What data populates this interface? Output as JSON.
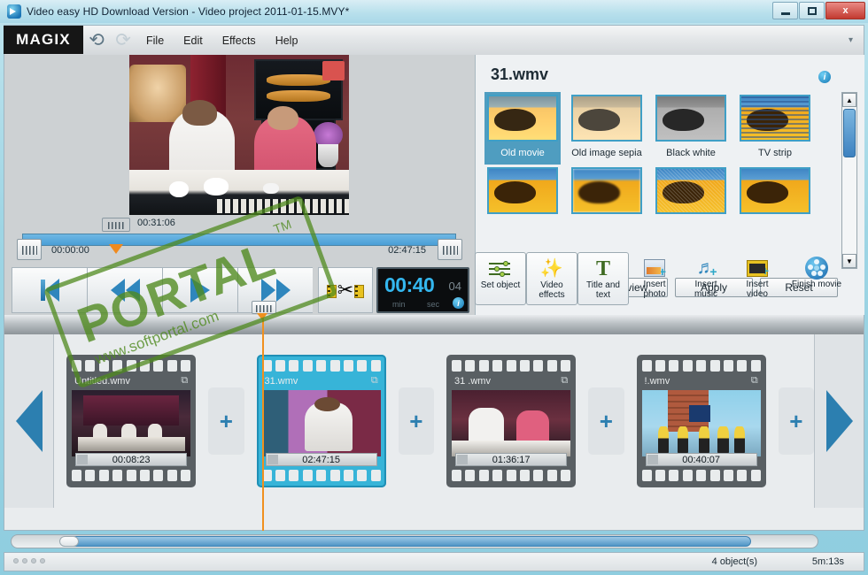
{
  "window": {
    "title": "Video easy HD Download Version - Video project 2011-01-15.MVY*",
    "app_icon": "video-app-icon",
    "minimize_label": "Minimize",
    "maximize_label": "Maximize",
    "close_label": "x"
  },
  "menubar": {
    "logo": "MAGIX",
    "undo_icon": "undo-arrow-icon",
    "redo_icon": "redo-arrow-icon",
    "items": [
      "File",
      "Edit",
      "Effects",
      "Help"
    ],
    "caret": "▾"
  },
  "preview": {
    "marker_time": "00:31:06",
    "start_time": "00:00:00",
    "end_time": "02:47:15"
  },
  "transport": {
    "buttons": [
      {
        "name": "skip-start",
        "icon": "skip-to-start-icon"
      },
      {
        "name": "rewind",
        "icon": "rewind-icon"
      },
      {
        "name": "play",
        "icon": "play-icon"
      },
      {
        "name": "fast-forward",
        "icon": "fast-forward-icon"
      },
      {
        "name": "cut",
        "icon": "scissors-cut-icon"
      }
    ]
  },
  "time_display": {
    "main": "00:40",
    "frames": "04",
    "label_min": "min",
    "label_sec": "sec",
    "info_icon": "i"
  },
  "effects": {
    "title": "31.wmv",
    "info_icon": "i",
    "selected": "Old movie",
    "items": [
      {
        "label": "Old movie",
        "style": "old",
        "selected": true
      },
      {
        "label": "Old image sepia",
        "style": "sepia",
        "selected": false
      },
      {
        "label": "Black white",
        "style": "gray",
        "selected": false
      },
      {
        "label": "TV strip",
        "style": "strip",
        "selected": false
      },
      {
        "label": "",
        "style": "plain",
        "selected": false
      },
      {
        "label": "",
        "style": "blur",
        "selected": false
      },
      {
        "label": "",
        "style": "noise",
        "selected": false
      },
      {
        "label": "",
        "style": "plain",
        "selected": false
      }
    ],
    "actions": [
      "Preview",
      "Apply",
      "Reset"
    ],
    "scroll_up": "▲",
    "scroll_down": "▼"
  },
  "toolbar": {
    "items": [
      {
        "label": "Set object",
        "icon": "sliders-icon",
        "framed": true,
        "active": false
      },
      {
        "label": "Video\neffects",
        "icon": "magic-wand-icon",
        "framed": true,
        "active": true
      },
      {
        "label": "Title and\ntext",
        "icon": "text-T-icon",
        "framed": true,
        "active": false
      },
      {
        "label": "Insert\nphoto",
        "icon": "insert-photo-icon",
        "framed": false,
        "active": false
      },
      {
        "label": "Insert\nmusic",
        "icon": "insert-music-icon",
        "framed": false,
        "active": false
      },
      {
        "label": "Insert\nvideo",
        "icon": "insert-video-icon",
        "framed": false,
        "active": false
      },
      {
        "label": "Finish movie",
        "icon": "film-reel-icon",
        "framed": false,
        "active": false
      }
    ]
  },
  "timeline": {
    "nav_prev_icon": "prev-arrow-icon",
    "nav_next_icon": "next-arrow-icon",
    "add_label": "+",
    "clips": [
      {
        "name": "Untitled.wmv",
        "duration": "00:08:23",
        "selected": false,
        "thumb": "a",
        "mark": "⧉"
      },
      {
        "name": "31.wmv",
        "duration": "02:47:15",
        "selected": true,
        "thumb": "b",
        "mark": "⧉"
      },
      {
        "name": "31  .wmv",
        "duration": "01:36:17",
        "selected": false,
        "thumb": "c",
        "mark": "⧉"
      },
      {
        "name": "!.wmv",
        "duration": "00:40:07",
        "selected": false,
        "thumb": "d",
        "mark": "⧉"
      }
    ]
  },
  "statusbar": {
    "objects": "4 object(s)",
    "duration": "5m:13s"
  },
  "watermark": {
    "text": "PORTAL",
    "tm": "TM",
    "url": "www.softportal.com"
  },
  "colors": {
    "accent": "#2c7fb0",
    "selection": "#37b4d8",
    "playhead": "#f0901e",
    "lcd": "#34b7ef",
    "watermark": "#4f8a1e"
  }
}
